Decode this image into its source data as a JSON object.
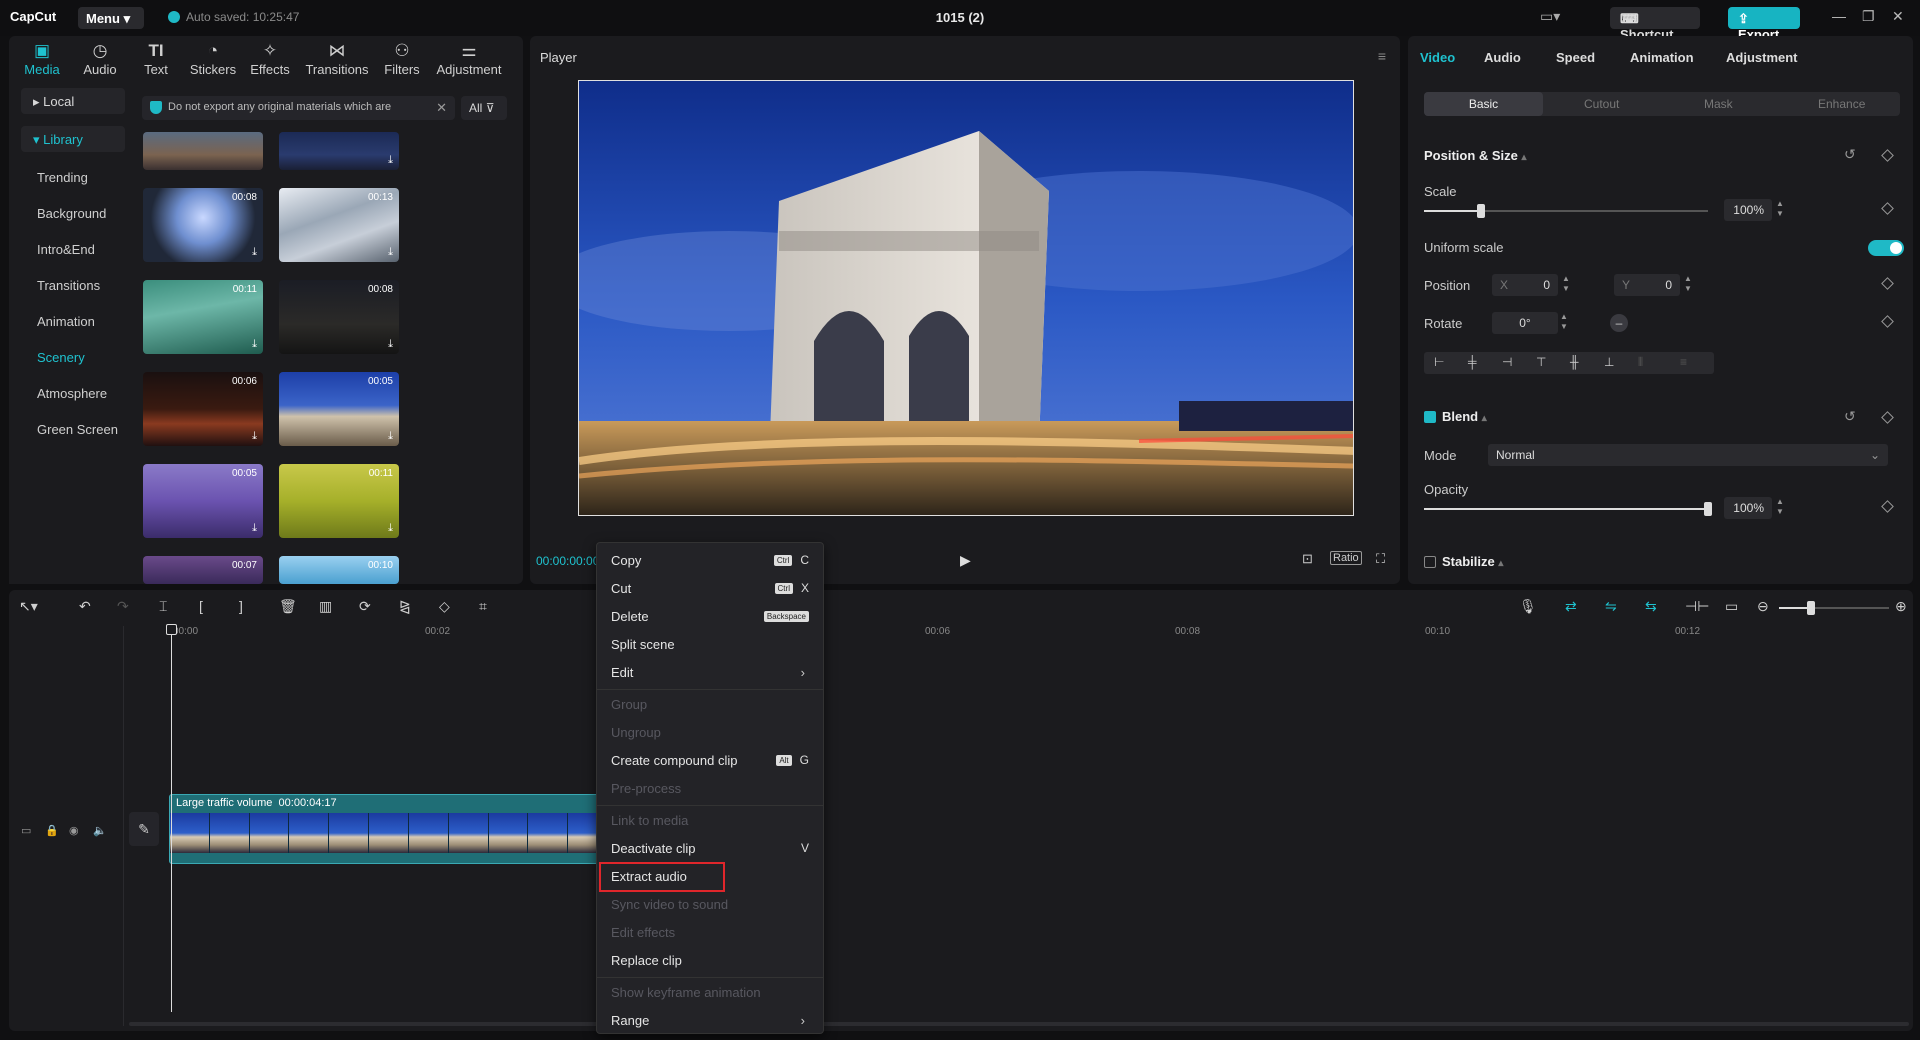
{
  "titlebar": {
    "logo": "CapCut",
    "menu_label": "Menu",
    "autosave": "Auto saved: 10:25:47",
    "project_title": "1015 (2)",
    "shortcut_label": "Shortcut",
    "export_label": "Export",
    "min_icon": "minimize-icon",
    "max_icon": "maximize-icon",
    "close_icon": "close-icon"
  },
  "media": {
    "tabs": [
      {
        "label": "Media",
        "icon": "media-icon"
      },
      {
        "label": "Audio",
        "icon": "audio-icon"
      },
      {
        "label": "Text",
        "icon": "text-icon"
      },
      {
        "label": "Stickers",
        "icon": "stickers-icon"
      },
      {
        "label": "Effects",
        "icon": "effects-icon"
      },
      {
        "label": "Transitions",
        "icon": "transitions-icon"
      },
      {
        "label": "Filters",
        "icon": "filters-icon"
      },
      {
        "label": "Adjustment",
        "icon": "adjustment-icon"
      }
    ],
    "sidebar": {
      "local": "Local",
      "library": "Library",
      "items": [
        "Trending",
        "Background",
        "Intro&End",
        "Transitions",
        "Animation",
        "Scenery",
        "Atmosphere",
        "Green Screen"
      ],
      "active_item": "Scenery"
    },
    "warning": "Do not export any original materials which are",
    "filter_label": "All",
    "thumbs": [
      {
        "duration": ""
      },
      {
        "duration": ""
      },
      {
        "duration": "00:08"
      },
      {
        "duration": "00:13"
      },
      {
        "duration": "00:11"
      },
      {
        "duration": "00:08"
      },
      {
        "duration": "00:06"
      },
      {
        "duration": "00:05"
      },
      {
        "duration": "00:05"
      },
      {
        "duration": "00:11"
      },
      {
        "duration": "00:07"
      },
      {
        "duration": "00:10"
      }
    ]
  },
  "player": {
    "title": "Player",
    "timecode": "00:00:00:00",
    "ratio_label": "Ratio"
  },
  "props": {
    "tabs": [
      "Video",
      "Audio",
      "Speed",
      "Animation",
      "Adjustment"
    ],
    "active_tab": "Video",
    "subtabs": [
      "Basic",
      "Cutout",
      "Mask",
      "Enhance"
    ],
    "position_size": "Position & Size",
    "scale_label": "Scale",
    "scale_value": "100%",
    "scale_fraction": 0.2,
    "uniform_scale": "Uniform scale",
    "position_label": "Position",
    "x_label": "X",
    "x_value": "0",
    "y_label": "Y",
    "y_value": "0",
    "rotate_label": "Rotate",
    "rotate_value": "0°",
    "blend": "Blend",
    "mode_label": "Mode",
    "mode_value": "Normal",
    "opacity_label": "Opacity",
    "opacity_value": "100%",
    "opacity_fraction": 1.0,
    "stabilize": "Stabilize"
  },
  "timeline": {
    "ruler": [
      "00:00",
      "00:02",
      "00:06",
      "00:08",
      "00:10",
      "00:12"
    ],
    "clip_title": "Large traffic volume",
    "clip_duration": "00:00:04:17"
  },
  "context_menu": {
    "items": [
      {
        "label": "Copy",
        "shortcut_mod": "Ctrl",
        "shortcut_key": "C",
        "enabled": true
      },
      {
        "label": "Cut",
        "shortcut_mod": "Ctrl",
        "shortcut_key": "X",
        "enabled": true
      },
      {
        "label": "Delete",
        "shortcut_mod": "Backspace",
        "shortcut_key": "",
        "enabled": true
      },
      {
        "label": "Split scene",
        "enabled": true
      },
      {
        "label": "Edit",
        "enabled": true,
        "submenu": true
      },
      {
        "label": "Group",
        "enabled": false
      },
      {
        "label": "Ungroup",
        "enabled": false
      },
      {
        "label": "Create compound clip",
        "shortcut_mod": "Alt",
        "shortcut_key": "G",
        "enabled": true
      },
      {
        "label": "Pre-process",
        "enabled": false
      },
      {
        "label": "Link to media",
        "enabled": false
      },
      {
        "label": "Deactivate clip",
        "shortcut_key": "V",
        "enabled": true
      },
      {
        "label": "Extract audio",
        "enabled": true,
        "highlighted": true
      },
      {
        "label": "Sync video to sound",
        "enabled": false
      },
      {
        "label": "Edit effects",
        "enabled": false
      },
      {
        "label": "Replace clip",
        "enabled": true
      },
      {
        "label": "Show keyframe animation",
        "enabled": false
      },
      {
        "label": "Range",
        "enabled": true,
        "submenu": true
      }
    ]
  },
  "colors": {
    "accent": "#1fc2cf",
    "highlight_box": "#e0262b",
    "clip": "#1f6e76"
  }
}
